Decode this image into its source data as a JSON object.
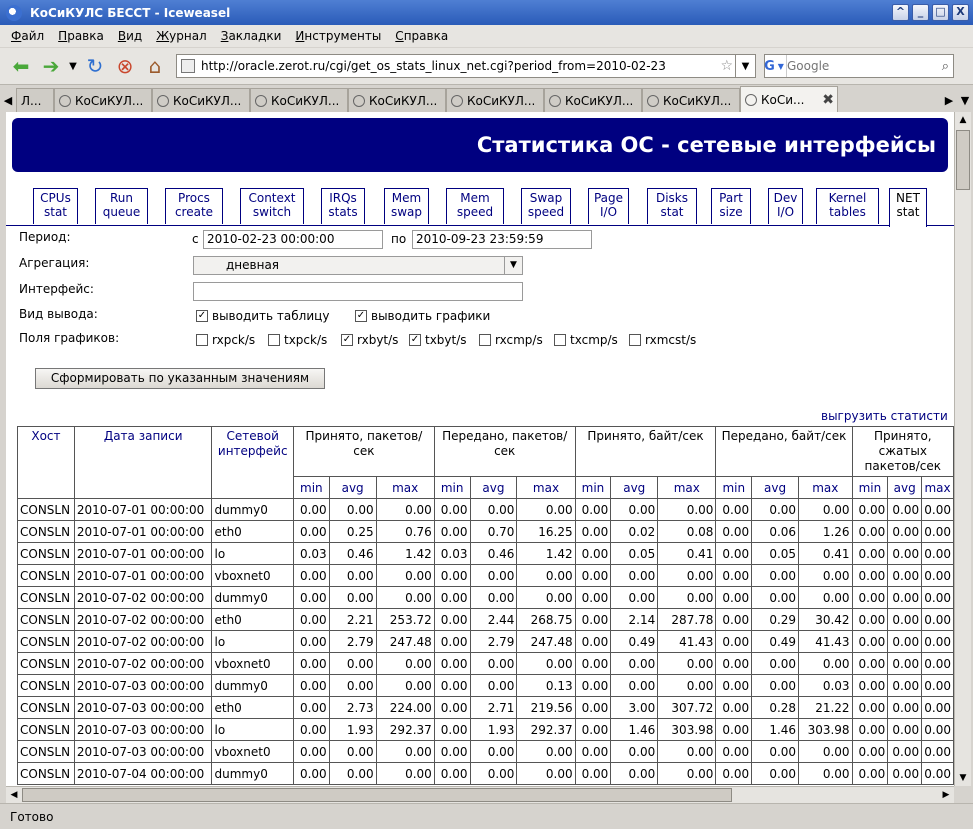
{
  "window": {
    "title": "КоСиКУЛС БЕССТ - Iceweasel",
    "buttons": [
      "^",
      "_",
      "□",
      "X"
    ]
  },
  "menu": [
    {
      "u": "Ф",
      "rest": "айл"
    },
    {
      "u": "П",
      "rest": "равка"
    },
    {
      "u": "В",
      "rest": "ид"
    },
    {
      "u": "Ж",
      "rest": "урнал"
    },
    {
      "u": "З",
      "rest": "акладки"
    },
    {
      "u": "И",
      "rest": "нструменты"
    },
    {
      "u": "С",
      "rest": "правка"
    }
  ],
  "nav": {
    "url": "http://oracle.zerot.ru/cgi/get_os_stats_linux_net.cgi?period_from=2010-02-23",
    "search_placeholder": "Google",
    "search_engine": "G"
  },
  "tabs": [
    {
      "label": "Л..."
    },
    {
      "label": "КоСиКУЛ..."
    },
    {
      "label": "КоСиКУЛ..."
    },
    {
      "label": "КоСиКУЛ..."
    },
    {
      "label": "КоСиКУЛ..."
    },
    {
      "label": "КоСиКУЛ..."
    },
    {
      "label": "КоСиКУЛ..."
    },
    {
      "label": "КоСиКУЛ..."
    },
    {
      "label": "КоСи..."
    }
  ],
  "status": "Готово",
  "page": {
    "title": "Статистика ОС - сетевые интерфейсы",
    "section_tabs": [
      {
        "l1": "CPUs",
        "l2": "stat"
      },
      {
        "l1": "Run",
        "l2": "queue"
      },
      {
        "l1": "Procs",
        "l2": "create"
      },
      {
        "l1": "Context",
        "l2": "switch"
      },
      {
        "l1": "IRQs",
        "l2": "stats"
      },
      {
        "l1": "Mem",
        "l2": "swap"
      },
      {
        "l1": "Mem",
        "l2": "speed"
      },
      {
        "l1": "Swap",
        "l2": "speed"
      },
      {
        "l1": "Page",
        "l2": "I/O"
      },
      {
        "l1": "Disks",
        "l2": "stat"
      },
      {
        "l1": "Part",
        "l2": "size"
      },
      {
        "l1": "Dev",
        "l2": "I/O"
      },
      {
        "l1": "Kernel",
        "l2": "tables"
      },
      {
        "l1": "NET",
        "l2": "stat"
      }
    ],
    "form": {
      "period_label": "Период:",
      "from_prefix": "с",
      "from_value": "2010-02-23 00:00:00",
      "to_prefix": "по",
      "to_value": "2010-09-23 23:59:59",
      "aggregation_label": "Агрегация:",
      "aggregation_value": "дневная",
      "interface_label": "Интерфейс:",
      "interface_value": "",
      "output_label": "Вид вывода:",
      "output_options": [
        {
          "label": "выводить таблицу",
          "checked": true
        },
        {
          "label": "выводить графики",
          "checked": true
        }
      ],
      "fields_label": "Поля графиков:",
      "fields": [
        {
          "label": "rxpck/s",
          "checked": false
        },
        {
          "label": "txpck/s",
          "checked": false
        },
        {
          "label": "rxbyt/s",
          "checked": true
        },
        {
          "label": "txbyt/s",
          "checked": true
        },
        {
          "label": "rxcmp/s",
          "checked": false
        },
        {
          "label": "txcmp/s",
          "checked": false
        },
        {
          "label": "rxmcst/s",
          "checked": false
        }
      ],
      "submit_label": "Сформировать по указанным значениям",
      "export_link": "выгрузить статисти"
    },
    "table": {
      "col_host": "Хост",
      "col_date": "Дата записи",
      "col_iface": "Сетевой интерфейс",
      "groups": [
        "Принято, пакетов/сек",
        "Передано, пакетов/сек",
        "Принято, байт/сек",
        "Передано, байт/сек",
        "Принято, сжатых пакетов/сек"
      ],
      "sub": [
        "min",
        "avg",
        "max"
      ],
      "rows": [
        [
          "CONSLN",
          "2010-07-01 00:00:00",
          "dummy0",
          "0.00",
          "0.00",
          "0.00",
          "0.00",
          "0.00",
          "0.00",
          "0.00",
          "0.00",
          "0.00",
          "0.00",
          "0.00",
          "0.00",
          "0.00",
          "0.00",
          "0.00"
        ],
        [
          "CONSLN",
          "2010-07-01 00:00:00",
          "eth0",
          "0.00",
          "0.25",
          "0.76",
          "0.00",
          "0.70",
          "16.25",
          "0.00",
          "0.02",
          "0.08",
          "0.00",
          "0.06",
          "1.26",
          "0.00",
          "0.00",
          "0.00"
        ],
        [
          "CONSLN",
          "2010-07-01 00:00:00",
          "lo",
          "0.03",
          "0.46",
          "1.42",
          "0.03",
          "0.46",
          "1.42",
          "0.00",
          "0.05",
          "0.41",
          "0.00",
          "0.05",
          "0.41",
          "0.00",
          "0.00",
          "0.00"
        ],
        [
          "CONSLN",
          "2010-07-01 00:00:00",
          "vboxnet0",
          "0.00",
          "0.00",
          "0.00",
          "0.00",
          "0.00",
          "0.00",
          "0.00",
          "0.00",
          "0.00",
          "0.00",
          "0.00",
          "0.00",
          "0.00",
          "0.00",
          "0.00"
        ],
        [
          "CONSLN",
          "2010-07-02 00:00:00",
          "dummy0",
          "0.00",
          "0.00",
          "0.00",
          "0.00",
          "0.00",
          "0.00",
          "0.00",
          "0.00",
          "0.00",
          "0.00",
          "0.00",
          "0.00",
          "0.00",
          "0.00",
          "0.00"
        ],
        [
          "CONSLN",
          "2010-07-02 00:00:00",
          "eth0",
          "0.00",
          "2.21",
          "253.72",
          "0.00",
          "2.44",
          "268.75",
          "0.00",
          "2.14",
          "287.78",
          "0.00",
          "0.29",
          "30.42",
          "0.00",
          "0.00",
          "0.00"
        ],
        [
          "CONSLN",
          "2010-07-02 00:00:00",
          "lo",
          "0.00",
          "2.79",
          "247.48",
          "0.00",
          "2.79",
          "247.48",
          "0.00",
          "0.49",
          "41.43",
          "0.00",
          "0.49",
          "41.43",
          "0.00",
          "0.00",
          "0.00"
        ],
        [
          "CONSLN",
          "2010-07-02 00:00:00",
          "vboxnet0",
          "0.00",
          "0.00",
          "0.00",
          "0.00",
          "0.00",
          "0.00",
          "0.00",
          "0.00",
          "0.00",
          "0.00",
          "0.00",
          "0.00",
          "0.00",
          "0.00",
          "0.00"
        ],
        [
          "CONSLN",
          "2010-07-03 00:00:00",
          "dummy0",
          "0.00",
          "0.00",
          "0.00",
          "0.00",
          "0.00",
          "0.13",
          "0.00",
          "0.00",
          "0.00",
          "0.00",
          "0.00",
          "0.03",
          "0.00",
          "0.00",
          "0.00"
        ],
        [
          "CONSLN",
          "2010-07-03 00:00:00",
          "eth0",
          "0.00",
          "2.73",
          "224.00",
          "0.00",
          "2.71",
          "219.56",
          "0.00",
          "3.00",
          "307.72",
          "0.00",
          "0.28",
          "21.22",
          "0.00",
          "0.00",
          "0.00"
        ],
        [
          "CONSLN",
          "2010-07-03 00:00:00",
          "lo",
          "0.00",
          "1.93",
          "292.37",
          "0.00",
          "1.93",
          "292.37",
          "0.00",
          "1.46",
          "303.98",
          "0.00",
          "1.46",
          "303.98",
          "0.00",
          "0.00",
          "0.00"
        ],
        [
          "CONSLN",
          "2010-07-03 00:00:00",
          "vboxnet0",
          "0.00",
          "0.00",
          "0.00",
          "0.00",
          "0.00",
          "0.00",
          "0.00",
          "0.00",
          "0.00",
          "0.00",
          "0.00",
          "0.00",
          "0.00",
          "0.00",
          "0.00"
        ],
        [
          "CONSLN",
          "2010-07-04 00:00:00",
          "dummy0",
          "0.00",
          "0.00",
          "0.00",
          "0.00",
          "0.00",
          "0.00",
          "0.00",
          "0.00",
          "0.00",
          "0.00",
          "0.00",
          "0.00",
          "0.00",
          "0.00",
          "0.00"
        ]
      ]
    }
  }
}
